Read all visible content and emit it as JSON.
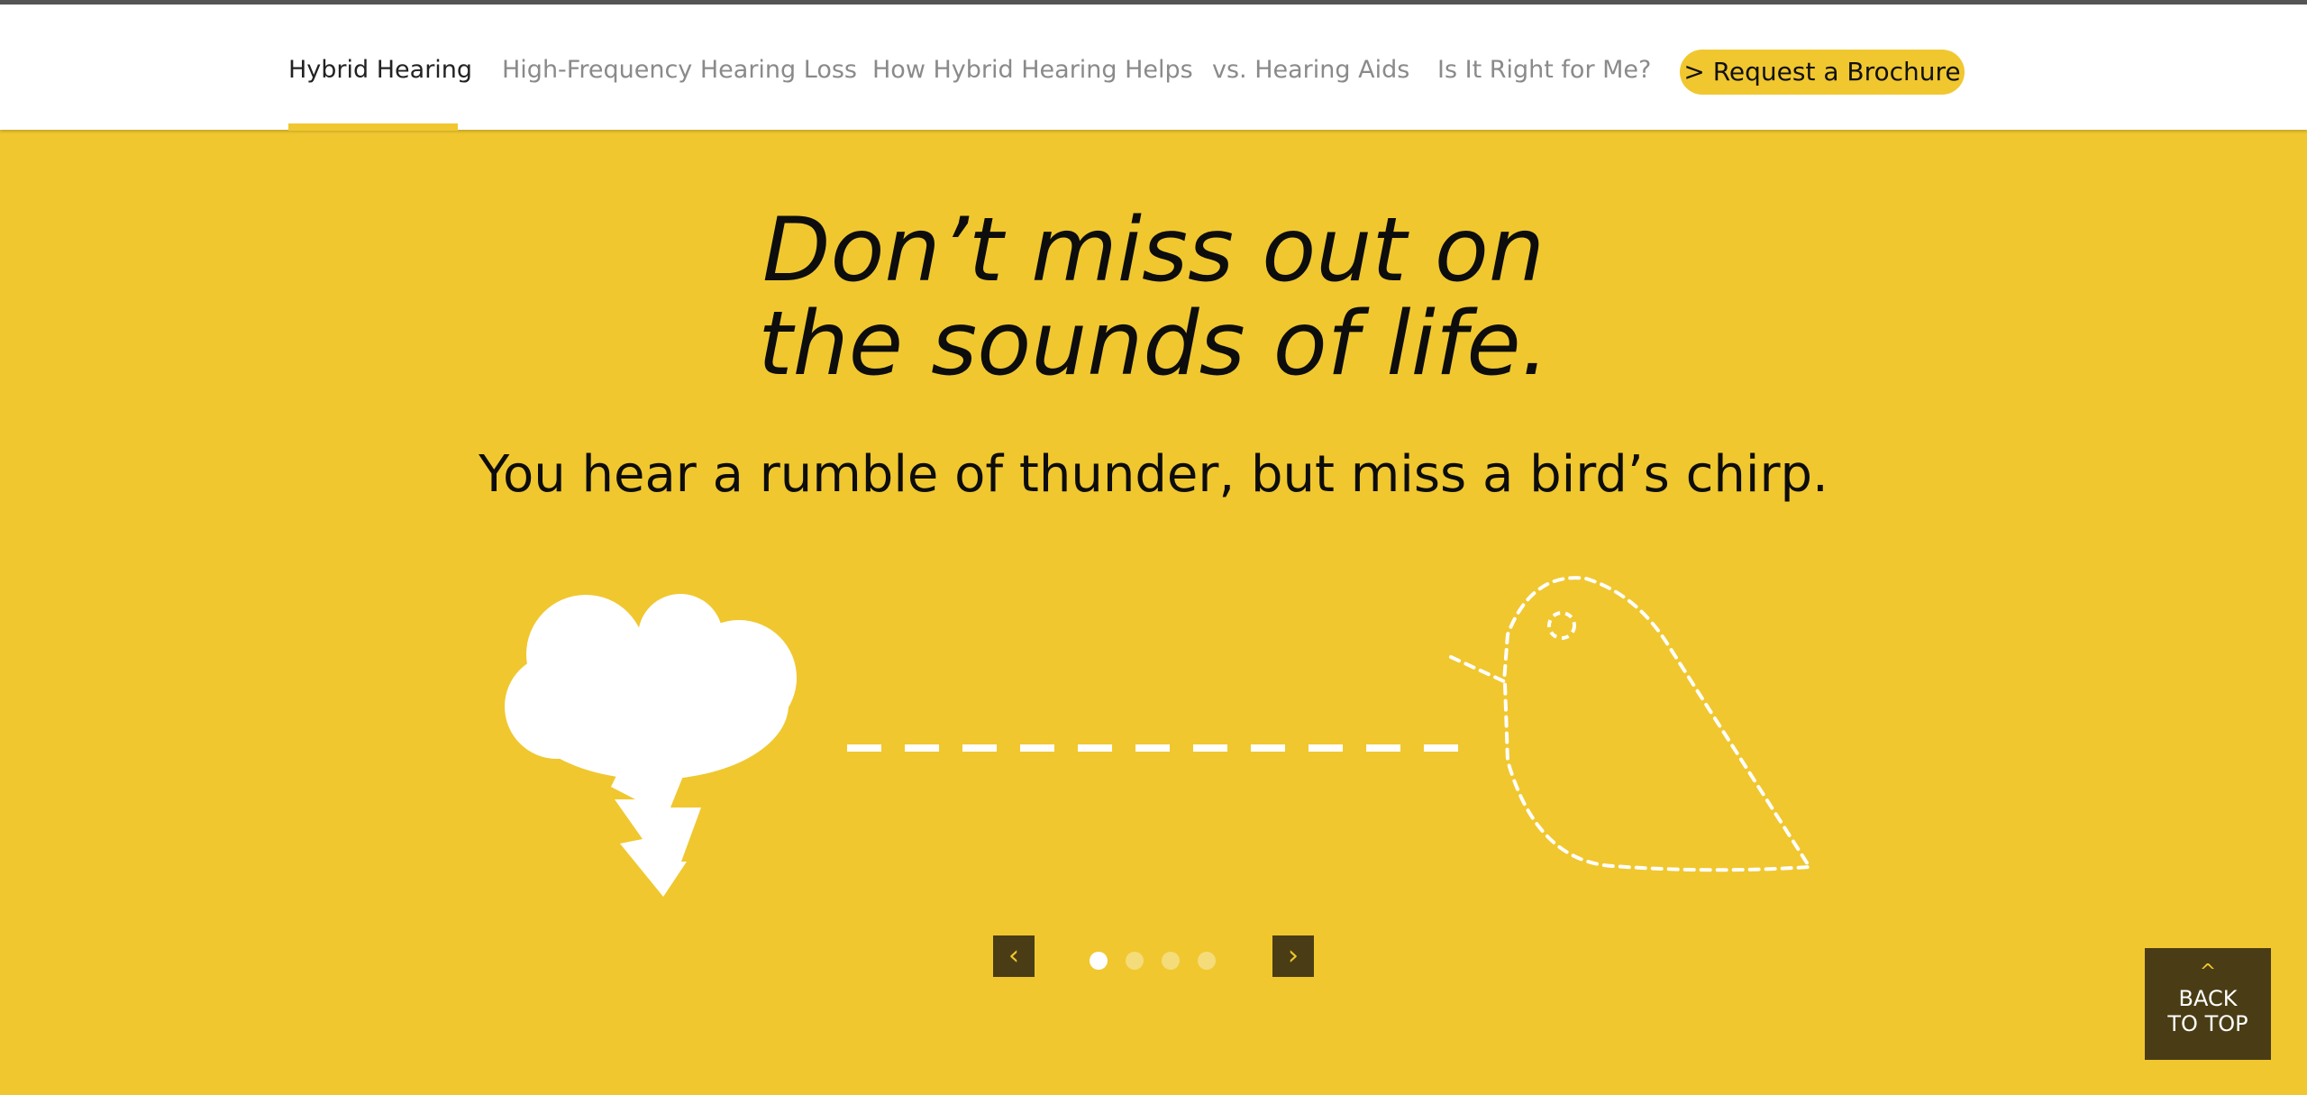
{
  "nav": {
    "items": [
      {
        "label": "Hybrid Hearing"
      },
      {
        "label": "High-Frequency Hearing Loss"
      },
      {
        "label": "How Hybrid Hearing Helps"
      },
      {
        "label": "vs. Hearing Aids"
      },
      {
        "label": "Is It Right for Me?"
      }
    ],
    "active_index": 0,
    "cta_label": "> Request a Brochure"
  },
  "hero": {
    "headline_line1": "Don’t miss out on",
    "headline_line2": "the sounds of life.",
    "subline": "You hear a rumble of thunder, but miss a bird’s chirp.",
    "prev_icon": "chevron-left-icon",
    "next_icon": "chevron-right-icon",
    "prev_glyph": "‹",
    "next_glyph": "›",
    "slide_count": 4,
    "active_slide": 1
  },
  "back_to_top": {
    "caret": "^",
    "label": "BACK TO TOP"
  },
  "colors": {
    "accent_yellow": "#f0c72f",
    "dark_brown": "#4a3d15",
    "white": "#ffffff",
    "nav_text": "#8a8a8a",
    "nav_active_text": "#222222"
  }
}
